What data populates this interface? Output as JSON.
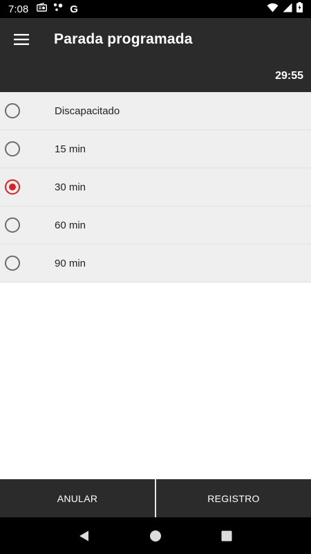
{
  "status_bar": {
    "time": "7:08",
    "left_icons": [
      "radio-icon",
      "assistant-dots-icon",
      "google-g-icon"
    ],
    "google_letter": "G",
    "right_icons": [
      "wifi-icon",
      "signal-icon",
      "battery-icon"
    ]
  },
  "app_bar": {
    "title": "Parada programada",
    "menu_icon": "hamburger-menu-icon"
  },
  "timer": {
    "value": "29:55"
  },
  "options": [
    {
      "label": "Discapacitado",
      "selected": false
    },
    {
      "label": "15 min",
      "selected": false
    },
    {
      "label": "30 min",
      "selected": true
    },
    {
      "label": "60 min",
      "selected": false
    },
    {
      "label": "90 min",
      "selected": false
    }
  ],
  "actions": {
    "cancel_label": "ANULAR",
    "register_label": "REGISTRO"
  },
  "nav_bar": {
    "icons": [
      "back-icon",
      "home-icon",
      "recents-icon"
    ]
  },
  "colors": {
    "app_bar": "#2b2b2b",
    "list_background": "#efefef",
    "radio_selected": "#e02020",
    "radio_unselected": "#6b6b6b"
  }
}
